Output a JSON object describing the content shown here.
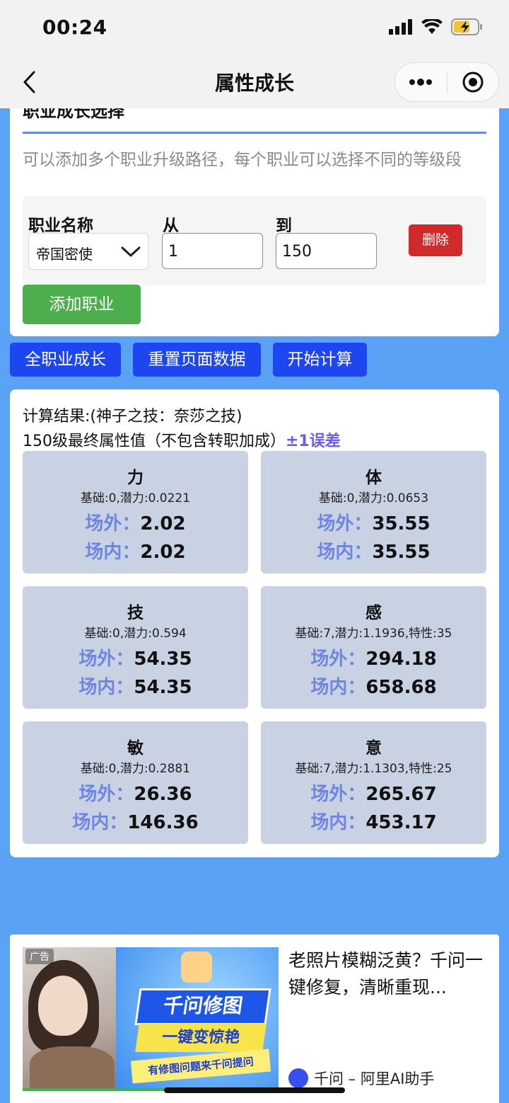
{
  "status_bar": {
    "time": "00:24"
  },
  "nav": {
    "title": "属性成长"
  },
  "career_section": {
    "title": "职业成长选择",
    "description": "可以添加多个职业升级路径，每个职业可以选择不同的等级段",
    "labels": {
      "job_name": "职业名称",
      "from": "从",
      "to": "到"
    },
    "row": {
      "job": "帝国密使",
      "from": "1",
      "to": "150",
      "delete": "删除"
    },
    "add_button": "添加职业"
  },
  "actions": {
    "all_growth": "全职业成长",
    "reset": "重置页面数据",
    "calculate": "开始计算"
  },
  "results": {
    "line1": "计算结果:(神子之技：奈莎之技)",
    "line2": "150级最终属性值（不包含转职加成）",
    "tolerance": "±1误差",
    "outside_label": "场外：",
    "inside_label": "场内：",
    "stats": [
      {
        "name": "力",
        "info": "基础:0,潜力:0.0221",
        "outside": "2.02",
        "inside": "2.02"
      },
      {
        "name": "体",
        "info": "基础:0,潜力:0.0653",
        "outside": "35.55",
        "inside": "35.55"
      },
      {
        "name": "技",
        "info": "基础:0,潜力:0.594",
        "outside": "54.35",
        "inside": "54.35"
      },
      {
        "name": "感",
        "info": "基础:7,潜力:1.1936,特性:35",
        "outside": "294.18",
        "inside": "658.68"
      },
      {
        "name": "敏",
        "info": "基础:0,潜力:0.2881",
        "outside": "26.36",
        "inside": "146.36"
      },
      {
        "name": "意",
        "info": "基础:7,潜力:1.1303,特性:25",
        "outside": "265.67",
        "inside": "453.17"
      }
    ]
  },
  "ad": {
    "tag": "广告",
    "banner_main": "千问修图",
    "banner_sub": "一键变惊艳",
    "banner_small": "有修图问题来千问提问",
    "text": "老照片模糊泛黄？千问一键修复，清晰重现...",
    "source": "千问 – 阿里AI助手"
  }
}
